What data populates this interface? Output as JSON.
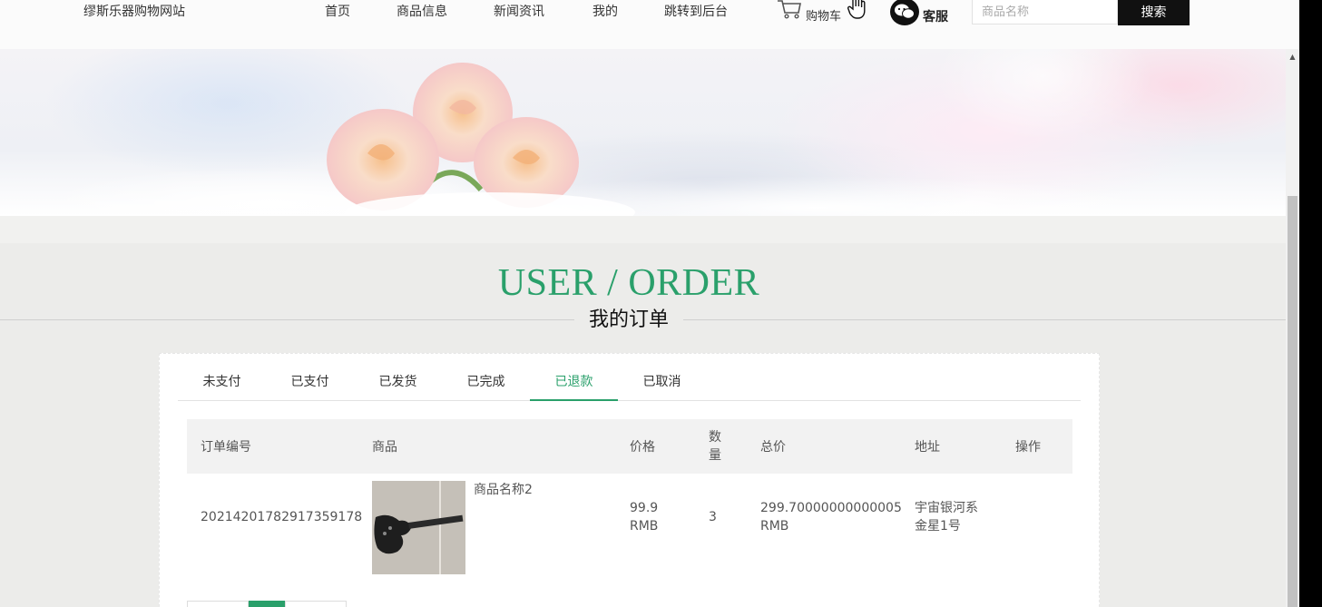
{
  "header": {
    "site_name": "缪斯乐器购物网站",
    "nav": [
      "首页",
      "商品信息",
      "新闻资讯",
      "我的",
      "跳转到后台"
    ],
    "cart_label": "购物车",
    "service_label": "客服",
    "search_placeholder": "商品名称",
    "search_button": "搜索"
  },
  "page": {
    "title_en": "USER / ORDER",
    "title_cn": "我的订单"
  },
  "tabs": [
    {
      "label": "未支付",
      "active": false
    },
    {
      "label": "已支付",
      "active": false
    },
    {
      "label": "已发货",
      "active": false
    },
    {
      "label": "已完成",
      "active": false
    },
    {
      "label": "已退款",
      "active": true
    },
    {
      "label": "已取消",
      "active": false
    }
  ],
  "table": {
    "headers": {
      "order_no": "订单编号",
      "product": "商品",
      "price": "价格",
      "qty_line1": "数",
      "qty_line2": "量",
      "total": "总价",
      "address": "地址",
      "action": "操作"
    },
    "rows": [
      {
        "order_no": "20214201782917359178",
        "product_name": "商品名称2",
        "price": "99.9",
        "price_unit": "RMB",
        "qty": "3",
        "total": "299.70000000000005",
        "total_unit": "RMB",
        "address_line1": "宇宙银河系",
        "address_line2": "金星1号"
      }
    ]
  },
  "colors": {
    "accent": "#2aa06b",
    "header_bg": "#fbfbfb",
    "page_bg": "#ececea",
    "search_button_bg": "#111111"
  },
  "icons": {
    "cart": "cart-icon",
    "service": "wechat-icon",
    "cursor": "hand-cursor-icon",
    "scroll_up": "scroll-up-arrow-icon"
  }
}
